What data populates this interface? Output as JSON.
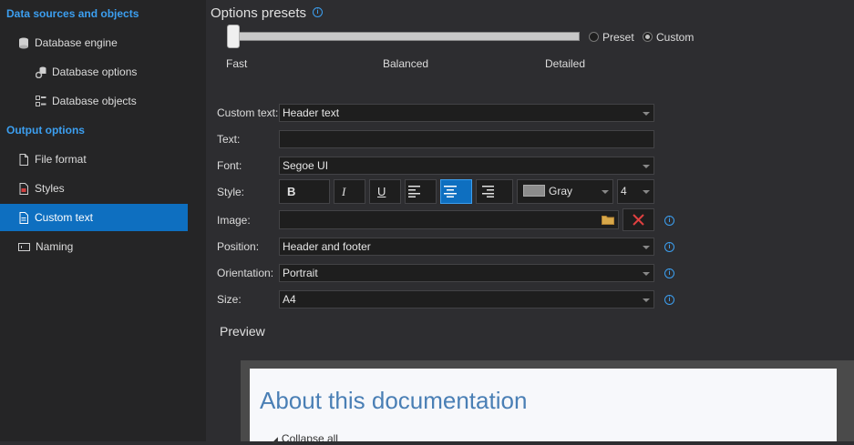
{
  "sidebar": {
    "sections": [
      {
        "title": "Data sources and objects"
      },
      {
        "title": "Output options"
      }
    ],
    "items": [
      {
        "label": "Database engine",
        "icon": "database-icon"
      },
      {
        "label": "Database options",
        "icon": "database-options-icon"
      },
      {
        "label": "Database objects",
        "icon": "database-objects-icon"
      },
      {
        "label": "File format",
        "icon": "file-icon"
      },
      {
        "label": "Styles",
        "icon": "styles-icon"
      },
      {
        "label": "Custom text",
        "icon": "custom-text-icon",
        "active": true
      },
      {
        "label": "Naming",
        "icon": "naming-icon"
      }
    ]
  },
  "presets": {
    "title": "Options presets",
    "slider_labels": [
      "Fast",
      "Balanced",
      "Detailed"
    ],
    "slider_value": "Fast",
    "radios": [
      {
        "label": "Preset",
        "checked": false
      },
      {
        "label": "Custom",
        "checked": true
      }
    ]
  },
  "form": {
    "custom_text": {
      "label": "Custom text:",
      "value": "Header text"
    },
    "text": {
      "label": "Text:",
      "value": ""
    },
    "font": {
      "label": "Font:",
      "value": "Segoe UI"
    },
    "style": {
      "label": "Style:",
      "bold": "B",
      "italic": "I",
      "underline": "U",
      "align_active": "center",
      "color": {
        "label": "Gray",
        "swatch": "#8c8c8c"
      },
      "size": "4"
    },
    "image": {
      "label": "Image:",
      "value": ""
    },
    "position": {
      "label": "Position:",
      "value": "Header and footer"
    },
    "orientation": {
      "label": "Orientation:",
      "value": "Portrait"
    },
    "size": {
      "label": "Size:",
      "value": "A4"
    }
  },
  "preview": {
    "title": "Preview",
    "doc_title": "About this documentation",
    "collapse_label": "Collapse all"
  },
  "colors": {
    "accent": "#3c9ff0",
    "active": "#0e6fc0",
    "background": "#2d2d30",
    "sidebar": "#252526"
  }
}
